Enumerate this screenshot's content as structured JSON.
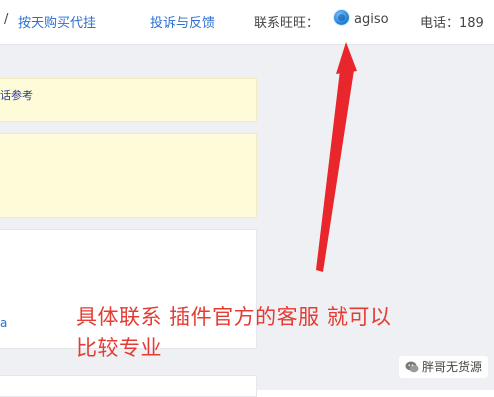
{
  "topbar": {
    "breadcrumb_sep": "/",
    "nav_link": "按天购买代挂",
    "feedback_link": "投诉与反馈",
    "contact_label": "联系旺旺：",
    "contact_icon": "aliwangwang-icon",
    "contact_name": "agiso",
    "phone_label": "电话：189"
  },
  "content": {
    "notice_text": "话参考",
    "partial_link": "a"
  },
  "annotation": {
    "caption_line1": "具体联系 插件官方的客服 就可以",
    "caption_line2": "比较专业",
    "arrow_color": "#e8262b"
  },
  "watermark": {
    "icon": "wechat-icon",
    "text": "胖哥无货源"
  }
}
